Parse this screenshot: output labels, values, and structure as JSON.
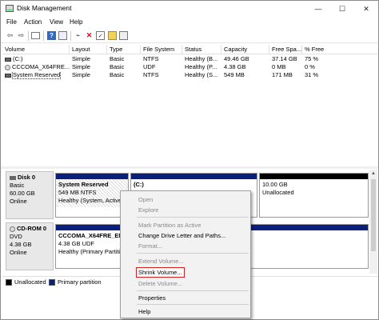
{
  "window": {
    "title": "Disk Management",
    "minimize_glyph": "—",
    "maximize_glyph": "☐",
    "close_glyph": "✕"
  },
  "menu": [
    "File",
    "Action",
    "View",
    "Help"
  ],
  "toolbar_icons": [
    "back-icon",
    "forward-icon",
    "console-icon",
    "help-icon",
    "properties-icon",
    "connect-icon",
    "delete-icon",
    "checkbox-icon",
    "open-icon",
    "view-icon"
  ],
  "volume_list": {
    "columns": [
      "Volume",
      "Layout",
      "Type",
      "File System",
      "Status",
      "Capacity",
      "Free Spa...",
      "% Free"
    ],
    "rows": [
      {
        "volume": "(C:)",
        "layout": "Simple",
        "type": "Basic",
        "fs": "NTFS",
        "status": "Healthy (B...",
        "capacity": "49.46 GB",
        "free": "37.14 GB",
        "pct": "75 %"
      },
      {
        "volume": "CCCOMA_X64FRE...",
        "layout": "Simple",
        "type": "Basic",
        "fs": "UDF",
        "status": "Healthy (P...",
        "capacity": "4.38 GB",
        "free": "0 MB",
        "pct": "0 %"
      },
      {
        "volume": "System Reserved",
        "layout": "Simple",
        "type": "Basic",
        "fs": "NTFS",
        "status": "Healthy (S...",
        "capacity": "549 MB",
        "free": "171 MB",
        "pct": "31 %"
      }
    ]
  },
  "disks": [
    {
      "name": "Disk 0",
      "kind": "Basic",
      "size": "60.00 GB",
      "state": "Online",
      "partitions": [
        {
          "name": "System Reserved",
          "line2": "549 MB NTFS",
          "line3": "Healthy (System, Active"
        },
        {
          "name": "(C:)",
          "line2": "",
          "line3": ""
        },
        {
          "name": "",
          "line2": "10.00 GB",
          "line3": "Unallocated"
        }
      ]
    },
    {
      "name": "CD-ROM 0",
      "kind": "DVD",
      "size": "4.38 GB",
      "state": "Online",
      "partitions": [
        {
          "name": "CCCOMA_X64FRE_EN-U",
          "line2": "4.38 GB UDF",
          "line3": "Healthy (Primary Partition"
        }
      ]
    }
  ],
  "legend": {
    "unallocated": "Unallocated",
    "primary": "Primary partition",
    "colors": {
      "unallocated": "#000000",
      "primary": "#0a1f7e"
    }
  },
  "context_menu": {
    "items": [
      {
        "label": "Open",
        "enabled": false
      },
      {
        "label": "Explore",
        "enabled": false
      },
      {
        "label": "Mark Partition as Active",
        "enabled": false
      },
      {
        "label": "Change Drive Letter and Paths...",
        "enabled": true
      },
      {
        "label": "Format...",
        "enabled": false
      },
      {
        "label": "Extend Volume...",
        "enabled": false
      },
      {
        "label": "Shrink Volume...",
        "enabled": true,
        "highlighted": true
      },
      {
        "label": "Delete Volume...",
        "enabled": false
      },
      {
        "label": "Properties",
        "enabled": true
      },
      {
        "label": "Help",
        "enabled": true
      }
    ],
    "highlight_color": "#d42020"
  }
}
